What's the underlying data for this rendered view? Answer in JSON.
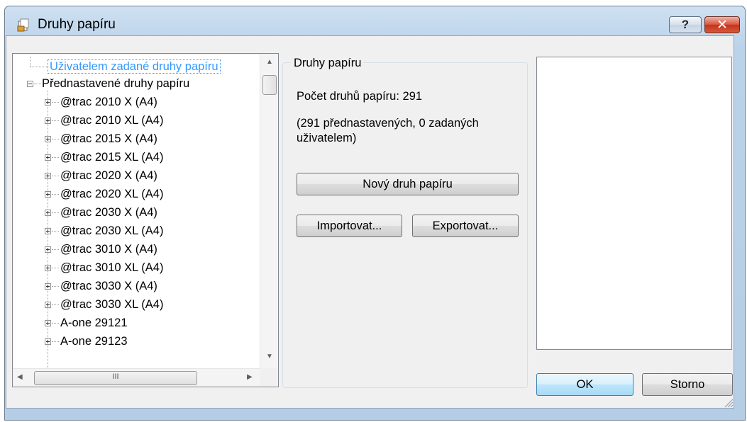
{
  "window": {
    "title": "Druhy papíru",
    "help_label": "?",
    "close_label": "✕"
  },
  "tree": {
    "root_user": "Uživatelem zadané druhy papíru",
    "root_preset": "Přednastavené druhy papíru",
    "children": [
      "@trac 2010 X (A4)",
      "@trac 2010 XL (A4)",
      "@trac 2015 X (A4)",
      "@trac 2015 XL (A4)",
      "@trac 2020 X (A4)",
      "@trac 2020 XL (A4)",
      "@trac 2030 X (A4)",
      "@trac 2030 XL (A4)",
      "@trac 3010 X (A4)",
      "@trac 3010 XL (A4)",
      "@trac 3030 X (A4)",
      "@trac 3030 XL (A4)",
      "A-one 29121",
      "A-one 29123"
    ],
    "hscroll_grip": "III"
  },
  "group": {
    "title": "Druhy papíru",
    "count_text": "Počet druhů papíru: 291",
    "sub_text": "(291 přednastavených, 0 zadaných uživatelem)",
    "new_button": "Nový druh papíru",
    "import_button": "Importovat...",
    "export_button": "Exportovat..."
  },
  "footer": {
    "ok_button": "OK",
    "cancel_button": "Storno"
  },
  "colors": {
    "selection_outline": "#3399ff",
    "close_button": "#c4331b",
    "titlebar": "#bad2ea"
  }
}
